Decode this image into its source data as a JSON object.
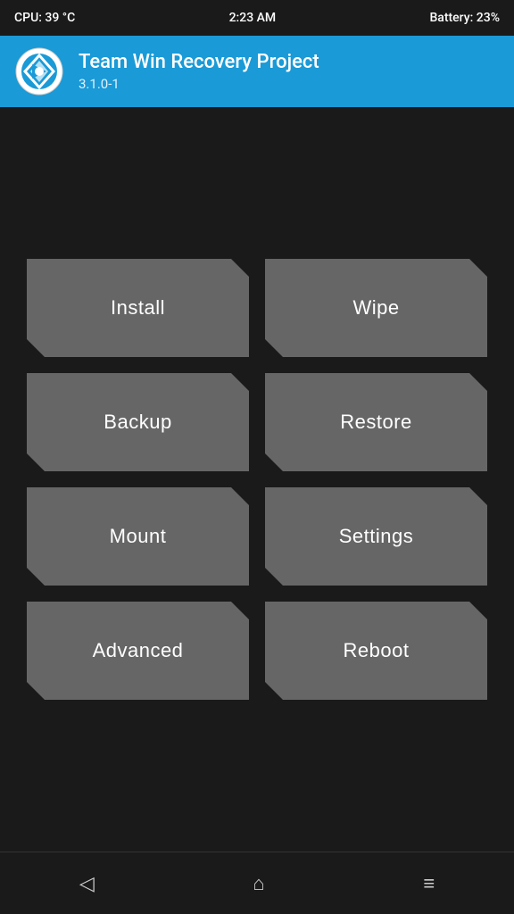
{
  "statusBar": {
    "cpu": "CPU: 39 °C",
    "time": "2:23 AM",
    "battery": "Battery: 23%"
  },
  "header": {
    "title": "Team Win Recovery Project",
    "version": "3.1.0-1"
  },
  "buttons": [
    [
      {
        "id": "install",
        "label": "Install"
      },
      {
        "id": "wipe",
        "label": "Wipe"
      }
    ],
    [
      {
        "id": "backup",
        "label": "Backup"
      },
      {
        "id": "restore",
        "label": "Restore"
      }
    ],
    [
      {
        "id": "mount",
        "label": "Mount"
      },
      {
        "id": "settings",
        "label": "Settings"
      }
    ],
    [
      {
        "id": "advanced",
        "label": "Advanced"
      },
      {
        "id": "reboot",
        "label": "Reboot"
      }
    ]
  ],
  "navBar": {
    "back": "◁",
    "home": "⌂",
    "menu": "≡"
  }
}
